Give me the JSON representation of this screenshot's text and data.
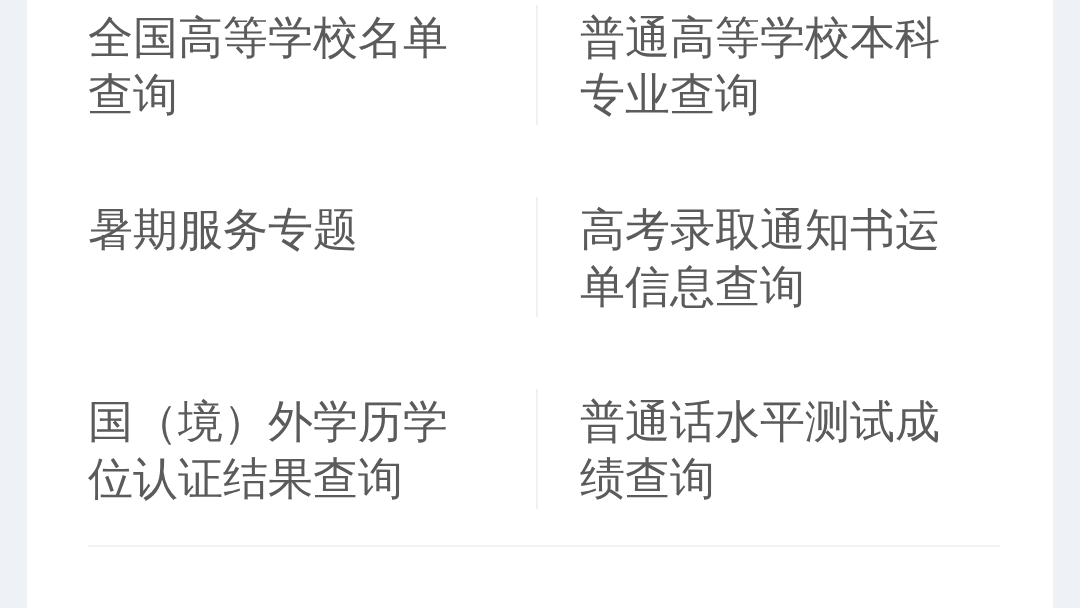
{
  "services": [
    {
      "label": "全国高等学校名单查询"
    },
    {
      "label": "普通高等学校本科专业查询"
    },
    {
      "label": "暑期服务专题"
    },
    {
      "label": "高考录取通知书运单信息查询"
    },
    {
      "label": "国（境）外学历学位认证结果查询"
    },
    {
      "label": "普通话水平测试成绩查询"
    }
  ]
}
